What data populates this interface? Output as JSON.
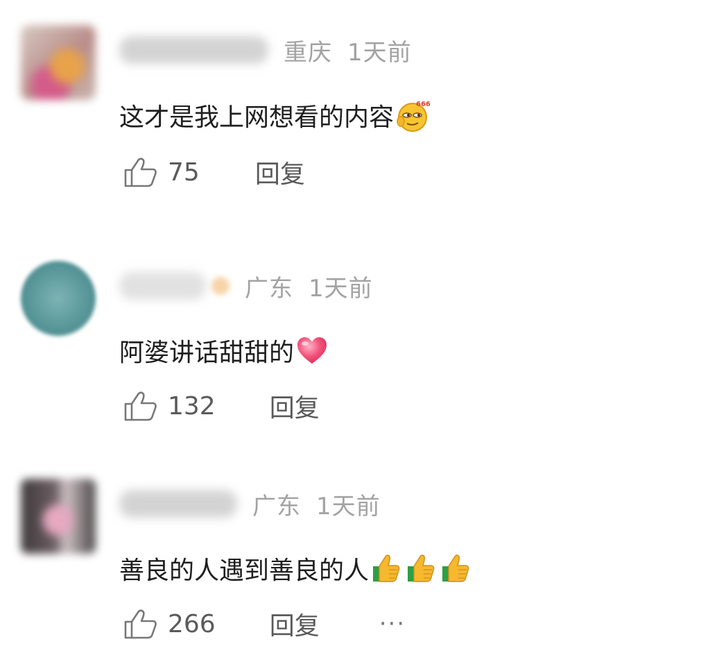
{
  "comments": [
    {
      "location": "重庆",
      "time": "1天前",
      "text": "这才是我上网想看的内容",
      "emoji": "smug-666-emoji-icon",
      "likes": "75",
      "reply": "回复"
    },
    {
      "location": "广东",
      "time": "1天前",
      "text": "阿婆讲话甜甜的",
      "emoji": "heart-emoji-icon",
      "likes": "132",
      "reply": "回复"
    },
    {
      "location": "广东",
      "time": "1天前",
      "text": "善良的人遇到善良的人",
      "emoji": "thumbs-up-emoji-icon",
      "likes": "266",
      "reply": "回复",
      "more": "···"
    }
  ]
}
